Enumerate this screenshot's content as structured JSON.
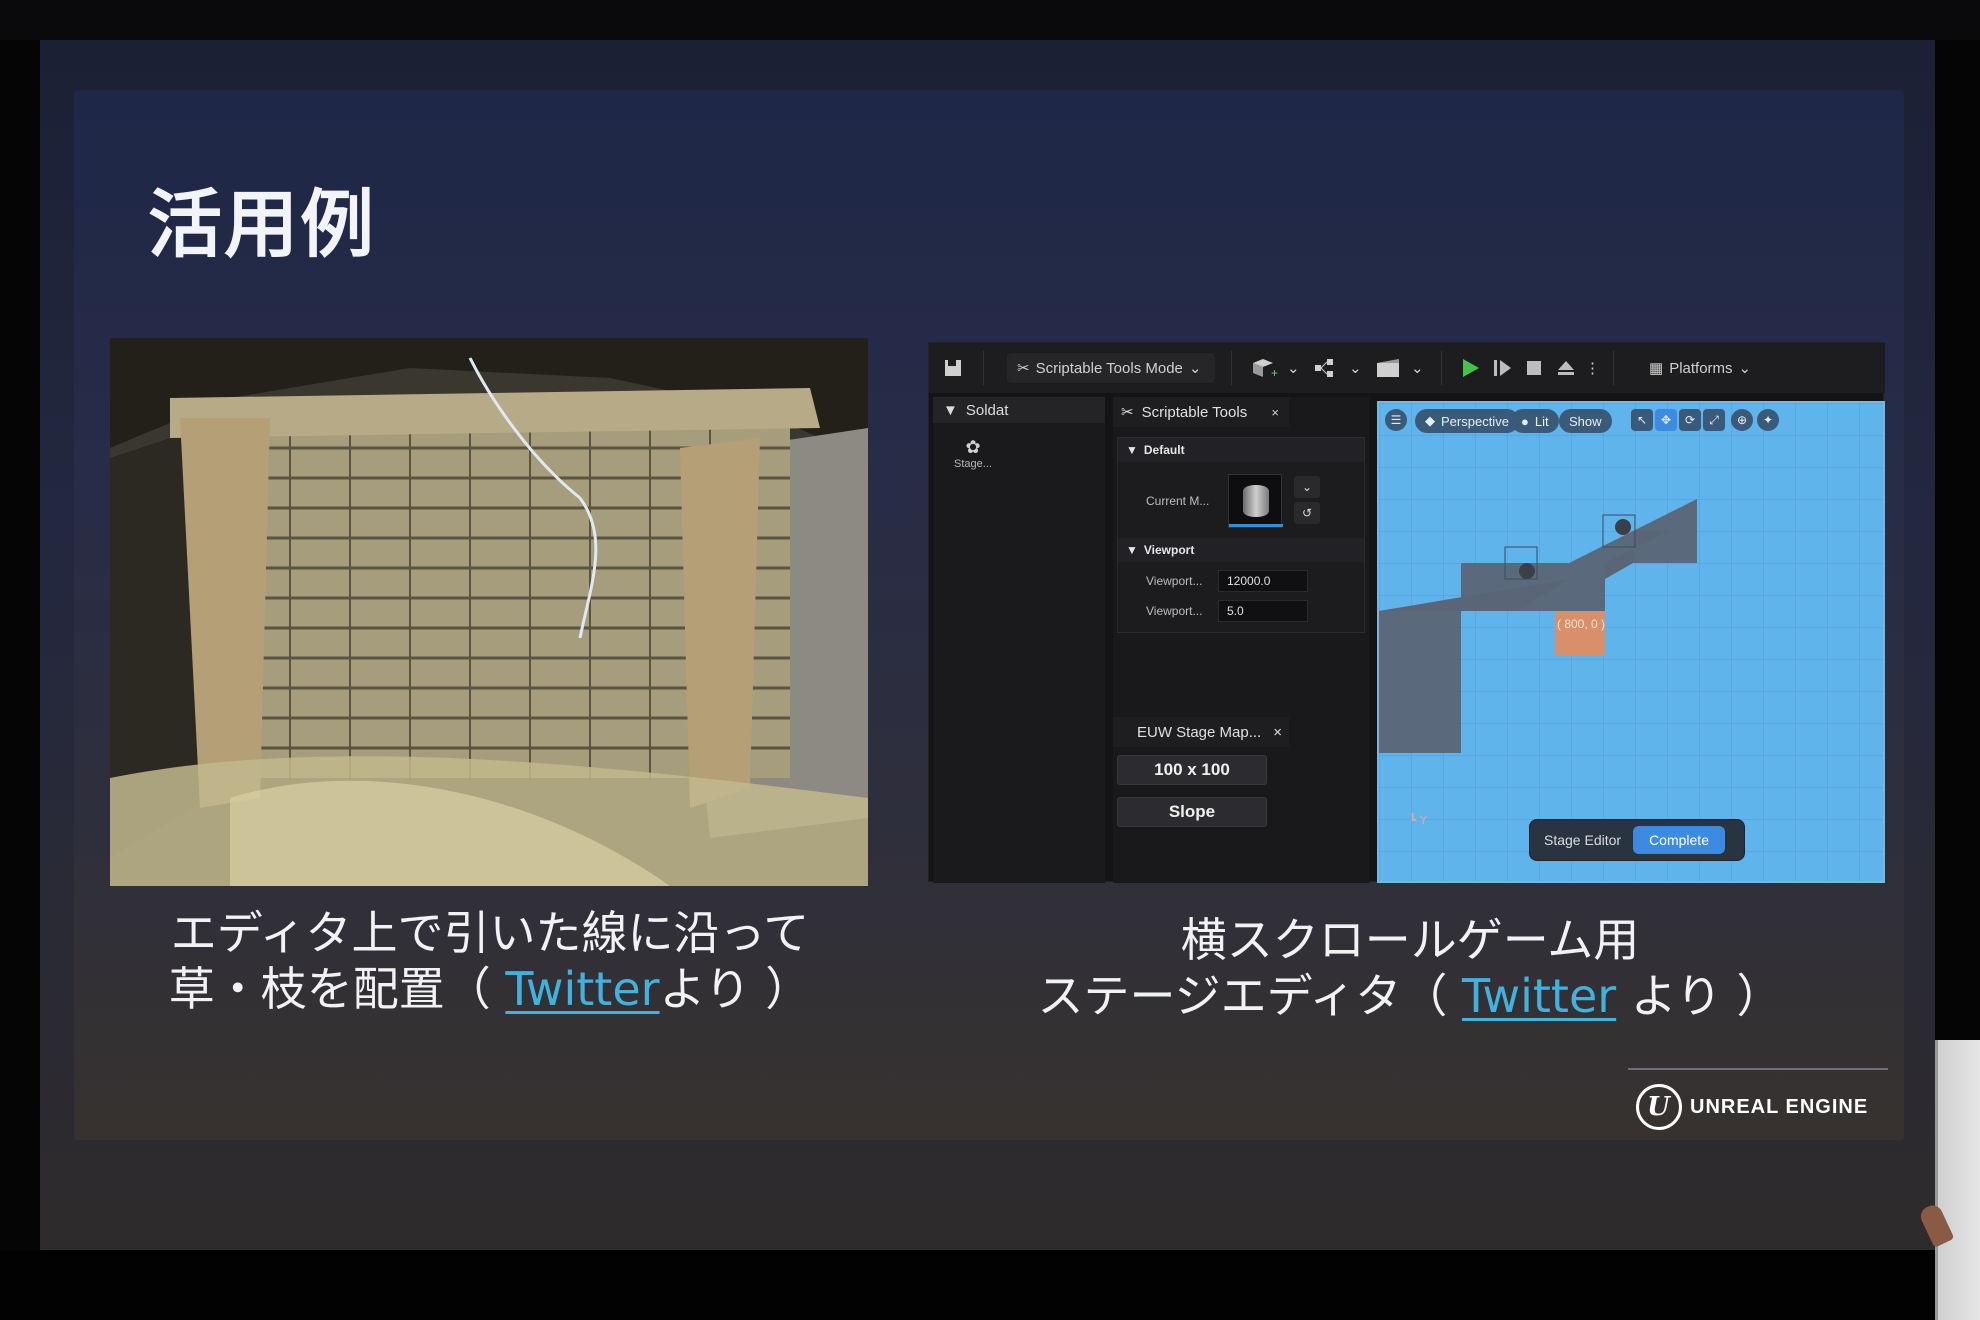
{
  "slide": {
    "title": "活用例"
  },
  "left_caption": {
    "line1": "エディタ上で引いた線に沿って",
    "line2_prefix": "草・枝を配置（ ",
    "link": "Twitter",
    "line2_suffix": "より ）"
  },
  "right_caption": {
    "line1": "横スクロールゲーム用",
    "line2_prefix": "ステージエディタ（ ",
    "link": "Twitter",
    "line2_suffix": " より ）"
  },
  "editor": {
    "toolbar": {
      "mode_label": "Scriptable Tools Mode",
      "platforms_label": "Platforms"
    },
    "outliner": {
      "tab_label": "Soldat",
      "item_label": "Stage..."
    },
    "tools_panel": {
      "tab_label": "Scriptable Tools",
      "close_glyph": "×",
      "section_default": "Default",
      "current_label": "Current M...",
      "section_viewport": "Viewport",
      "prop1_label": "Viewport...",
      "prop1_value": "12000.0",
      "prop2_label": "Viewport...",
      "prop2_value": "5.0"
    },
    "euw": {
      "tab_label": "EUW Stage Map...",
      "close_glyph": "×",
      "size_button": "100 x 100",
      "slope_button": "Slope"
    },
    "viewport": {
      "perspective_label": "Perspective",
      "lit_label": "Lit",
      "show_label": "Show",
      "coord_text": "( 800, 0 )",
      "stage_editor_label": "Stage Editor",
      "complete_label": "Complete",
      "axis_label": "Y"
    }
  },
  "logo": {
    "mark": "U",
    "text": "UNREAL ENGINE"
  },
  "colors": {
    "link": "#41b1dd",
    "viewport_bg": "#5fb4ec",
    "complete_button": "#3d8be0"
  }
}
